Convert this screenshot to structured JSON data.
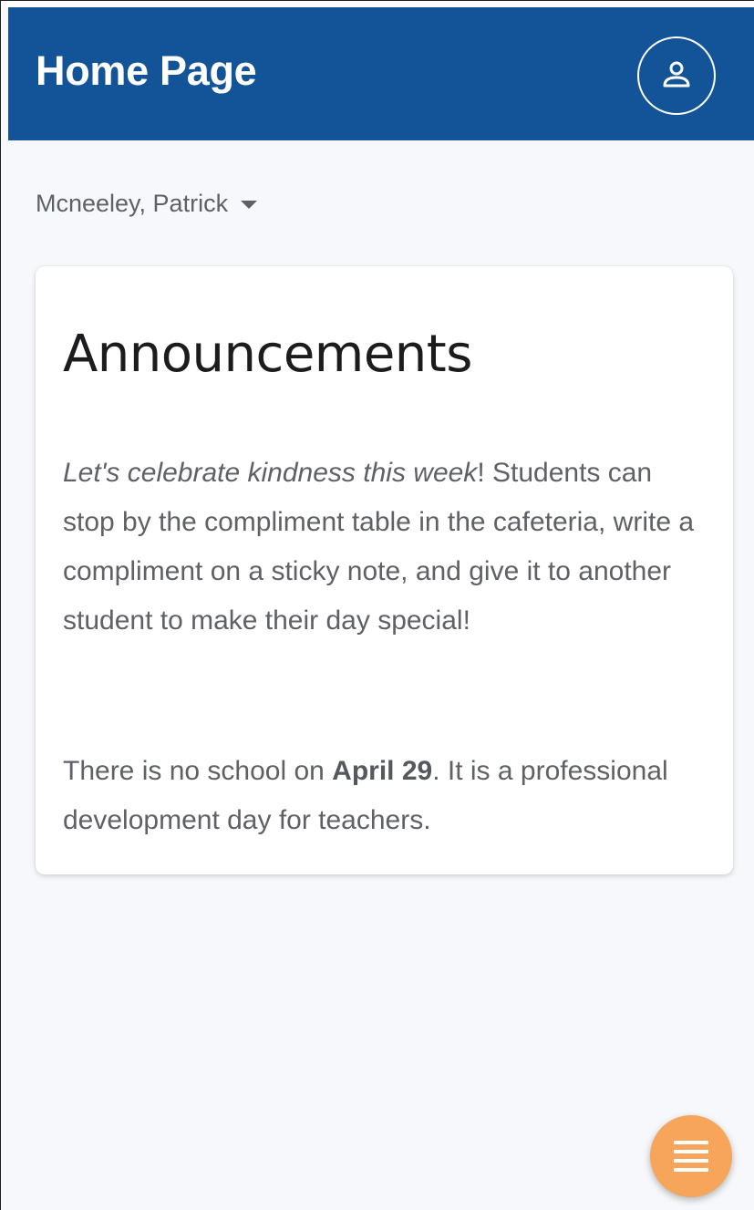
{
  "header": {
    "title": "Home Page",
    "background_color": "#135498",
    "account_icon": "user-icon"
  },
  "user_selector": {
    "name": "Mcneeley, Patrick",
    "icon": "caret-down-icon"
  },
  "announcements": {
    "title": "Announcements",
    "paragraph1_emphasis": "Let's celebrate kindness this week",
    "paragraph1_rest": "! Students can stop by the compliment table in the cafeteria, write a compliment on a sticky note, and give it to another student to make their day special!",
    "paragraph2_prefix": "There is no school on ",
    "paragraph2_bold": "April 29",
    "paragraph2_suffix": ". It is a professional development day for teachers."
  },
  "fab": {
    "icon": "menu-icon",
    "color": "#f6a55a"
  }
}
